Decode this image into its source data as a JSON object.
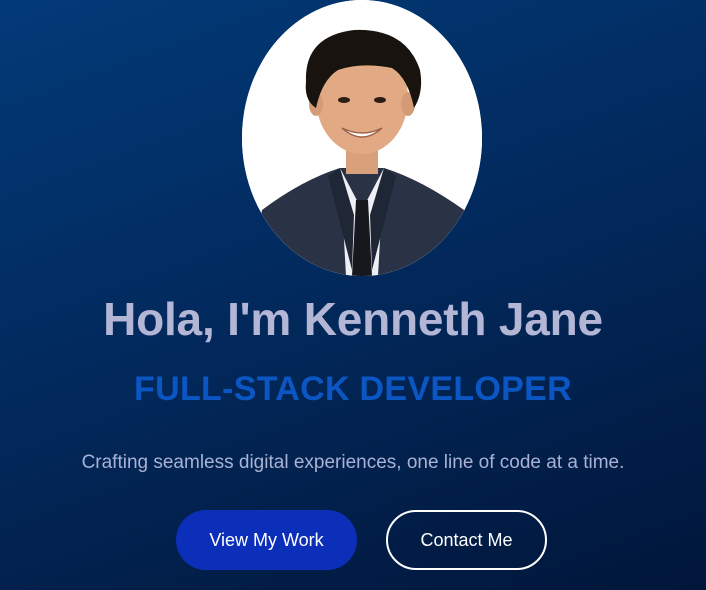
{
  "hero": {
    "greeting": "Hola, I'm Kenneth Jane",
    "role": "FULL-STACK DEVELOPER",
    "tagline": "Crafting seamless digital experiences, one line of code at a time.",
    "primary_button": "View My Work",
    "secondary_button": "Contact Me"
  },
  "colors": {
    "background_start": "#023a78",
    "background_end": "#01163a",
    "headline": "#b4b6d6",
    "role": "#0b56c2",
    "primary_button": "#0c2fb9"
  }
}
